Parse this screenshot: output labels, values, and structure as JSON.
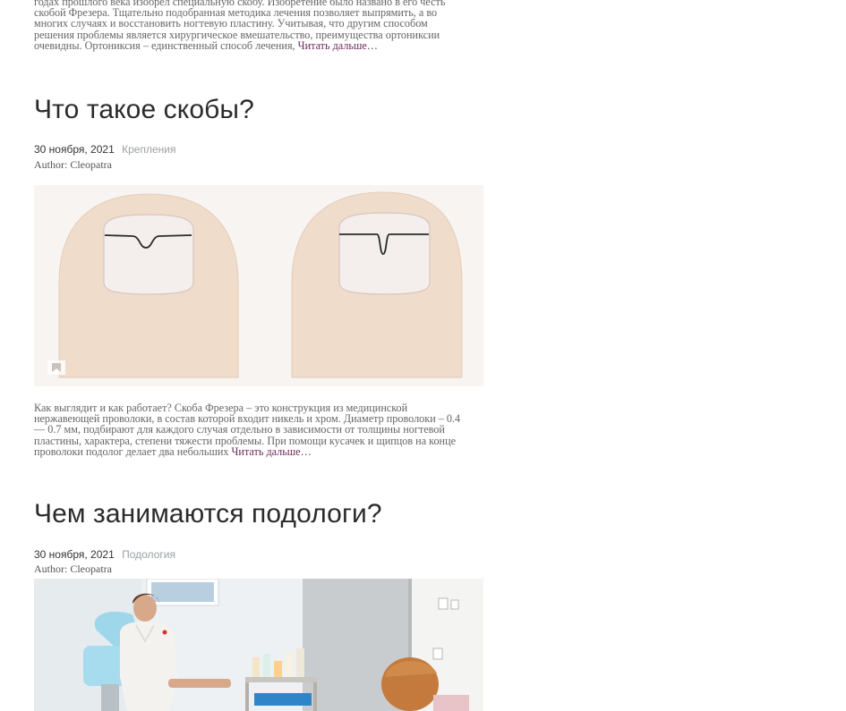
{
  "post_top": {
    "excerpt_lines": [
      "годах прошлого века изобрел специальную скобу. Изобретение было названо в его честь",
      "скобой Фрезера. Тщательно подобранная методика лечения позволяет выпрямить, а во",
      "многих случаях и восстановить ногтевую пластину. Учитывая, что другим способом",
      "решения проблемы является хирургическое вмешательство, преимущества ортониксии",
      "очевидны. Ортониксия – единственный способ лечения,"
    ],
    "read_more": "Читать дальше…"
  },
  "post1": {
    "title": "Что такое скобы?",
    "date": "30 ноября, 2021",
    "category": "Крепления",
    "author": "Author: Cleopatra",
    "excerpt_lines": [
      "Как выглядит и как работает? Скоба Фрезера – это конструкция из медицинской",
      "нержавеющей проволоки, в состав которой входит никель и хром. Диаметр проволоки – 0.4",
      "— 0.7 мм, подбирают для каждого случая отдельно в зависимости от толщины ногтевой",
      "пластины, характера, степени тяжести проблемы. При помощи кусачек и щипцов на конце",
      "проволоки подолог делает два небольших"
    ],
    "read_more": "Читать дальше…"
  },
  "post2": {
    "title": "Чем занимаются подологи?",
    "date": "30 ноября, 2021",
    "category": "Подология",
    "author": "Author: Cleopatra"
  },
  "colors": {
    "link": "#6a2b5a",
    "category": "#9aa0a6",
    "text": "#666666"
  }
}
